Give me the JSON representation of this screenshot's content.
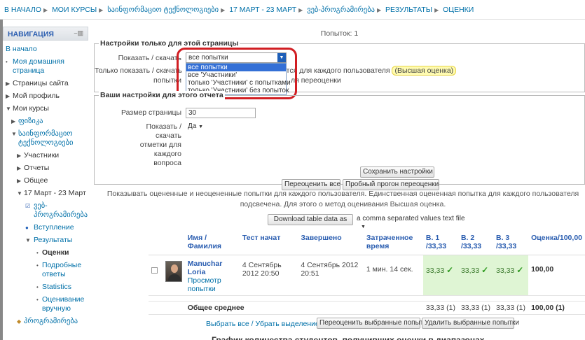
{
  "breadcrumb": [
    "В НАЧАЛО",
    "МОИ КУРСЫ",
    "საინფორმაციო ტექნოლოგიები",
    "17 МАРТ - 23 МАРТ",
    "ვებ-პროგრამირება",
    "РЕЗУЛЬТАТЫ",
    "ОЦЕНКИ"
  ],
  "sidebar": {
    "heading": "НАВИГАЦИЯ",
    "items": [
      {
        "label": "В начало"
      },
      {
        "label": "Моя домашняя страница"
      },
      {
        "label": "Страницы сайта"
      },
      {
        "label": "Мой профиль"
      },
      {
        "label": "Мои курсы"
      },
      {
        "label": "ფიზიკა"
      },
      {
        "label": "საინფორმაციო ტექნოლოგიები"
      },
      {
        "label": "Участники"
      },
      {
        "label": "Отчеты"
      },
      {
        "label": "Общее"
      },
      {
        "label": "17 Март - 23 Март"
      },
      {
        "label": "ვებ-პროგრამირება"
      },
      {
        "label": "Вступление"
      },
      {
        "label": "Результаты"
      },
      {
        "label": "Оценки"
      },
      {
        "label": "Подробные ответы"
      },
      {
        "label": "Statistics"
      },
      {
        "label": "Оценивание вручную"
      },
      {
        "label": "პროგრამირება"
      }
    ]
  },
  "attempts_label": "Попыток: 1",
  "page_settings": {
    "legend": "Настройки только для этой страницы",
    "show_label": "Показать / скачать",
    "show_value": "все попытки",
    "show_only_label_1": "Только показать / скачать",
    "show_only_label_2": "попытки",
    "dropdown_options": [
      "все попытки",
      "все 'Участники'",
      "только 'Участники' с попытками",
      "только 'Участники' без попыток"
    ],
    "after_text": "ются для каждого пользователя",
    "highlight_text": "(Высшая оценка)",
    "regrade_text": "ля переоценки"
  },
  "report_settings": {
    "legend": "Ваши настройки для этого отчета",
    "page_size_label": "Размер страницы",
    "page_size_value": "30",
    "marks_label": "Показать / скачать отметки для каждого вопроса",
    "marks_value": "Да",
    "save_button": "Сохранить настройки"
  },
  "buttons": {
    "regrade_all": "Переоценить все",
    "dry_run": "Пробный прогон переоценки",
    "download": "Download table data as",
    "download_format": "a comma separated values text file",
    "select_all": "Выбрать все / Убрать выделение",
    "regrade_selected": "Переоценить выбранные попытки",
    "delete_selected": "Удалить выбранные попытки"
  },
  "note_text": "Показывать оцененные и неоцененные попытки для каждого пользователя. Единственная оцененная попытка для каждого пользователя подсвечена. Для этого о метод оценивания Высшая оценка.",
  "table": {
    "headers": [
      "Имя / Фамилия",
      "Тест начат",
      "Завершено",
      "Затраченное время",
      "В. 1 /33,33",
      "В. 2 /33,33",
      "В. 3 /33,33",
      "Оценка/100,00"
    ],
    "row": {
      "name": "Manuchar Loria",
      "review": "Просмотр попытки",
      "started": "4 Сентябрь 2012 20:50",
      "finished": "4 Сентябрь 2012 20:51",
      "time": "1 мин. 14 сек.",
      "q1": "33,33",
      "q2": "33,33",
      "q3": "33,33",
      "grade": "100,00"
    },
    "avg": {
      "label": "Общее среднее",
      "q1": "33,33 (1)",
      "q2": "33,33 (1)",
      "q3": "33,33 (1)",
      "grade": "100,00 (1)"
    }
  },
  "bottom_cut_text": "График количества студентов, получивших оценки в диапазонах"
}
